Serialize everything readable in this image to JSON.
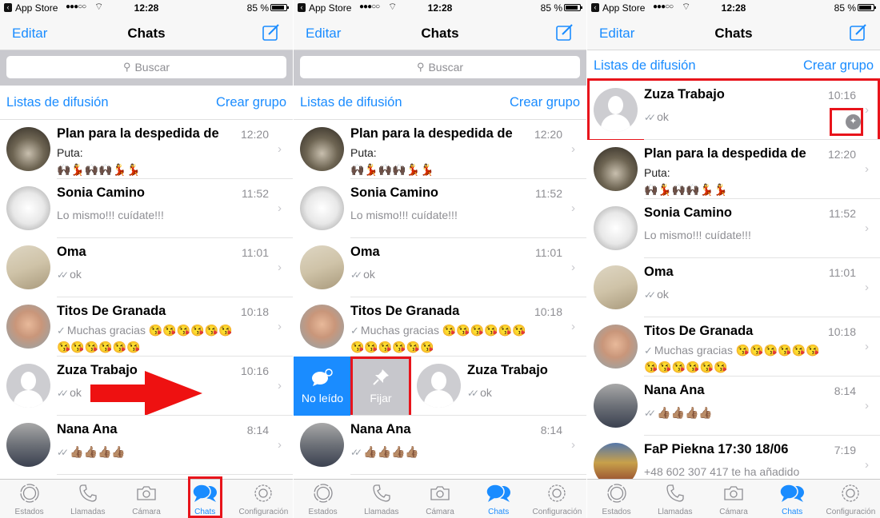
{
  "colors": {
    "accent": "#1a8cff",
    "highlight": "#e8141b",
    "secondary_text": "#8e8e93",
    "pin_action": "#c7c7cc"
  },
  "statusbar": {
    "back_app": "App Store",
    "signal": "●●●○○",
    "time": "12:28",
    "battery": "85 %"
  },
  "navbar": {
    "edit_label": "Editar",
    "title": "Chats",
    "compose_icon": "compose-icon"
  },
  "search": {
    "placeholder": "Buscar"
  },
  "links": {
    "broadcast": "Listas de difusión",
    "new_group": "Crear grupo"
  },
  "chats": {
    "plan": {
      "name": "Plan para la despedida de",
      "time": "12:20",
      "line1": "Puta:",
      "line2": "🙌🏿💃🙌🏿🙌🏿💃💃"
    },
    "sonia": {
      "name": "Sonia Camino",
      "time": "11:52",
      "message": "Lo mismo!!! cuídate!!!"
    },
    "oma": {
      "name": "Oma",
      "time": "11:01",
      "message": "ok",
      "ticks": "✓✓"
    },
    "titos": {
      "name": "Titos De Granada",
      "time": "10:18",
      "tick": "✓",
      "message": "Muchas gracias",
      "emojis1": "😘😘😘😘😘😘",
      "emojis2": "😘😘😘😘😘😘"
    },
    "zuza": {
      "name": "Zuza Trabajo",
      "time": "10:16",
      "message": "ok",
      "ticks": "✓✓"
    },
    "nana": {
      "name": "Nana Ana",
      "time": "8:14",
      "ticks": "✓✓",
      "emojis": "👍🏽👍🏽👍🏽👍🏽"
    },
    "fap": {
      "name": "FaP Piekna 17:30 18/06",
      "time": "7:19",
      "message": "+48 602 307 417 te ha añadido"
    }
  },
  "swipe_actions": {
    "unread_label": "No leído",
    "pin_label": "Fijar"
  },
  "tabs": [
    {
      "label": "Estados",
      "icon": "status-icon"
    },
    {
      "label": "Llamadas",
      "icon": "phone-icon"
    },
    {
      "label": "Cámara",
      "icon": "camera-icon"
    },
    {
      "label": "Chats",
      "icon": "chat-bubbles-icon",
      "active": true
    },
    {
      "label": "Configuración",
      "icon": "gear-icon"
    }
  ],
  "chevron": "›"
}
